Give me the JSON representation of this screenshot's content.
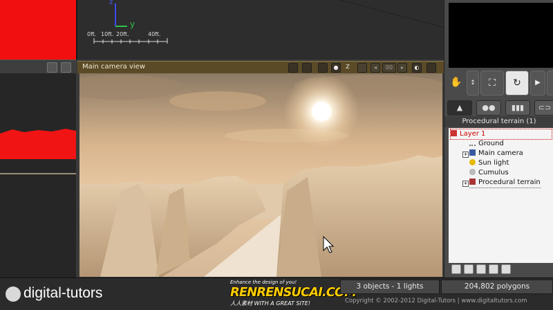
{
  "scale_bar": {
    "axis_z": "z",
    "axis_y": "y",
    "ticks": [
      "0ft.",
      "10ft.",
      "20ft.",
      "40ft."
    ]
  },
  "camera_view": {
    "title": "Main camera view",
    "buttons": [
      "camera-icon",
      "camera-settings-icon",
      "display-icon",
      "record-icon",
      "Z",
      "prev-icon",
      "frame-counter",
      "next-icon",
      "half-icon",
      "save-icon"
    ],
    "zoom_label": "Z",
    "counter": "00"
  },
  "navigation": {
    "buttons": [
      "hand-icon",
      "move-icon",
      "frame-icon",
      "rotate-icon",
      "play-icon"
    ]
  },
  "tabs": [
    "terrain-tab-icon",
    "spheres-tab-icon",
    "books-tab-icon",
    "chain-tab-icon"
  ],
  "object_tree": {
    "title": "Procedural terrain (1)",
    "items": [
      {
        "label": "Layer 1",
        "icon": "layer-icon",
        "selected": true
      },
      {
        "label": "Ground",
        "icon": "ground-icon"
      },
      {
        "label": "Main camera",
        "icon": "camera-icon",
        "expandable": true
      },
      {
        "label": "Sun light",
        "icon": "sun-icon"
      },
      {
        "label": "Cumulus",
        "icon": "cloud-icon"
      },
      {
        "label": "Procedural terrain",
        "icon": "terrain-icon",
        "expandable": true
      }
    ]
  },
  "status_bar": {
    "brand": "digital-tutors",
    "objects": "3 objects - 1 lights",
    "polygons": "204,802 polygons",
    "copyright": "Copyright © 2002-2012 Digital-Tutors  |  www.digitaltutors.com"
  },
  "watermark": {
    "tagline": "Enhance the design of you!",
    "name": "RENRENSUCAI.COM",
    "sub": "人人素材 WITH A GREAT SITE!"
  },
  "colors": {
    "accent_header": "#5a4a26",
    "selection": "#cc0000",
    "left_viewport_red": "#f20f10"
  }
}
